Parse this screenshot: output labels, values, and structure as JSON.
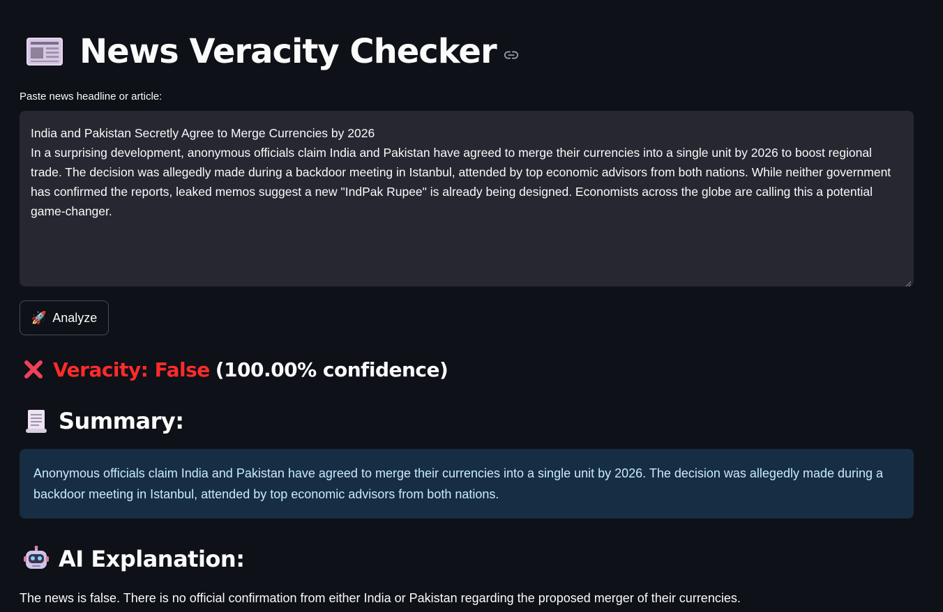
{
  "app": {
    "title": "News Veracity Checker",
    "title_icon": "newspaper-icon",
    "anchor_icon": "link-icon"
  },
  "input": {
    "label": "Paste news headline or article:",
    "value": "India and Pakistan Secretly Agree to Merge Currencies by 2026\nIn a surprising development, anonymous officials claim India and Pakistan have agreed to merge their currencies into a single unit by 2026 to boost regional trade. The decision was allegedly made during a backdoor meeting in Istanbul, attended by top economic advisors from both nations. While neither government has confirmed the reports, leaked memos suggest a new \"IndPak Rupee\" is already being designed. Economists across the globe are calling this a potential game-changer."
  },
  "button": {
    "label": "Analyze",
    "icon": "rocket-icon",
    "icon_glyph": "🚀"
  },
  "result": {
    "icon": "cross-mark-icon",
    "verdict_label": "Veracity: False",
    "confidence_text": "(100.00% confidence)",
    "verdict_color": "#ff2b2b"
  },
  "summary": {
    "heading": "Summary:",
    "icon": "scroll-icon",
    "text": "Anonymous officials claim India and Pakistan have agreed to merge their currencies into a single unit by 2026. The decision was allegedly made during a backdoor meeting in Istanbul, attended by top economic advisors from both nations.",
    "bg_color": "#172d43",
    "text_color": "#c7ebff"
  },
  "explanation": {
    "heading": "AI Explanation:",
    "icon": "robot-icon",
    "text": "The news is false. There is no official confirmation from either India or Pakistan regarding the proposed merger of their currencies."
  },
  "colors": {
    "background": "#0e1117",
    "input_bg": "#262730",
    "text": "#fafafa"
  }
}
